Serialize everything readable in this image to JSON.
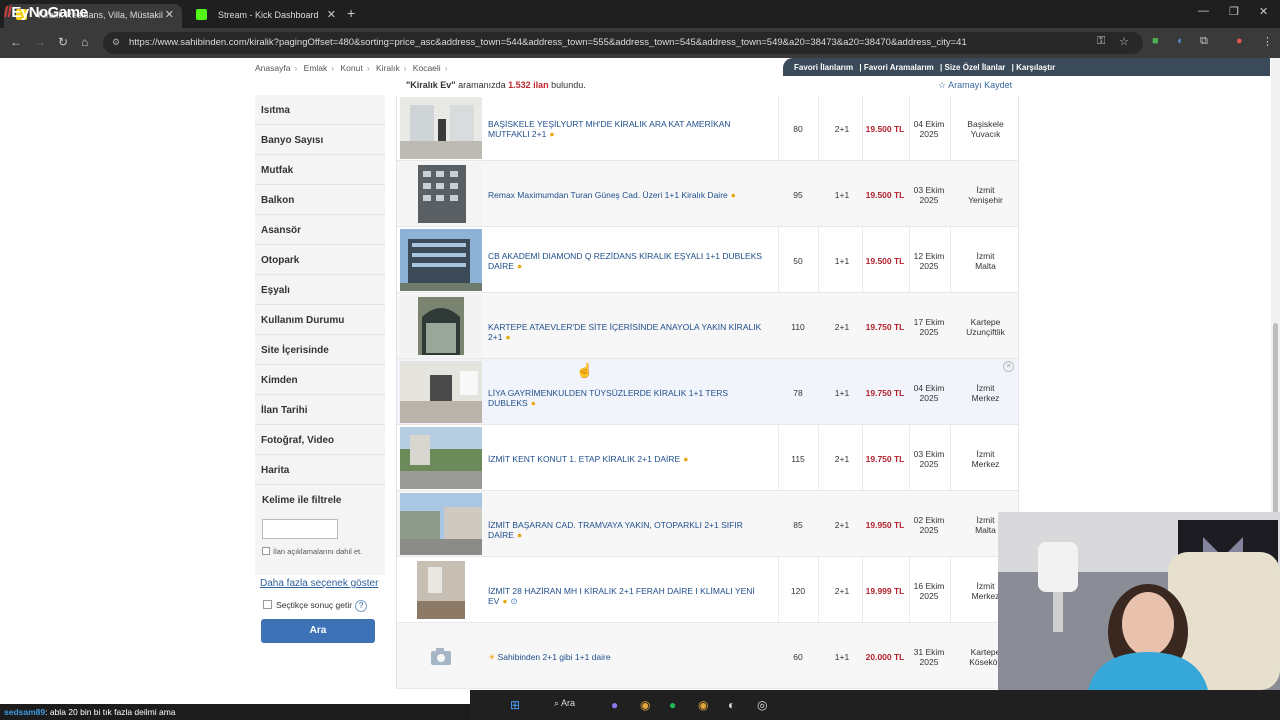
{
  "browser": {
    "logo_watermark": "EyNoGame",
    "tabs": [
      {
        "label": "Kiralık Residans, Villa, Müstakil",
        "active": true
      },
      {
        "label": "Stream - Kick Dashboard",
        "active": false
      }
    ],
    "url": "https://www.sahibinden.com/kiralik?pagingOffset=480&sorting=price_asc&address_town=544&address_town=555&address_town=545&address_town=549&a20=38473&a20=38470&address_city=41"
  },
  "breadcrumbs": [
    "Anasayfa",
    "Emlak",
    "Konut",
    "Kiralık",
    "Kocaeli"
  ],
  "top_nav": [
    "Favori İlanlarım",
    "Favori Aramalarım",
    "Size Özel İlanlar",
    "Karşılaştır"
  ],
  "results": {
    "query": "\"Kiralık Ev\"",
    "prefix": "aramanızda",
    "count": "1.532 ilan",
    "suffix": "bulundu.",
    "save_search": "Aramayı Kaydet"
  },
  "sidebar": {
    "filters": [
      "Isıtma",
      "Banyo Sayısı",
      "Mutfak",
      "Balkon",
      "Asansör",
      "Otopark",
      "Eşyalı",
      "Kullanım Durumu",
      "Site İçerisinde",
      "Kimden",
      "İlan Tarihi",
      "Fotoğraf, Video",
      "Harita"
    ],
    "keyword_title": "Kelime ile filtrele",
    "keyword_value": "",
    "keyword_checkbox": "İlan açıklamalarını dahil et.",
    "more_options": "Daha fazla seçenek göster",
    "selected_results": "Seçtikçe sonuç getir",
    "search_button": "Ara"
  },
  "listings": [
    {
      "title": "BAŞİSKELE YEŞİLYURT MH'DE KİRALIK ARA KAT AMERİKAN MUTFAKLI 2+1",
      "m2": "80",
      "rooms": "2+1",
      "price": "19.500 TL",
      "date_day": "04 Ekim",
      "date_year": "2025",
      "loc1": "Başiskele",
      "loc2": "Yuvacık"
    },
    {
      "title": "Remax Maximumdan Turan Güneş Cad. Üzeri 1+1 Kiralık Daire",
      "m2": "95",
      "rooms": "1+1",
      "price": "19.500 TL",
      "date_day": "03 Ekim",
      "date_year": "2025",
      "loc1": "İzmit",
      "loc2": "Yenişehir"
    },
    {
      "title": "CB AKADEMİ DIAMOND Q REZİDANS KİRALIK EŞYALI 1+1 DUBLEKS DAİRE",
      "m2": "50",
      "rooms": "1+1",
      "price": "19.500 TL",
      "date_day": "12 Ekim",
      "date_year": "2025",
      "loc1": "İzmit",
      "loc2": "Malta"
    },
    {
      "title": "KARTEPE ATAEVLER'DE SİTE İÇERİSİNDE ANAYOLA YAKIN KİRALIK 2+1",
      "m2": "110",
      "rooms": "2+1",
      "price": "19.750 TL",
      "date_day": "17 Ekim",
      "date_year": "2025",
      "loc1": "Kartepe",
      "loc2": "Uzunçiftlik"
    },
    {
      "title": "LİYA GAYRİMENKULDEN TÜYSÜZLERDE KİRALIK 1+1 TERS DUBLEKS",
      "m2": "78",
      "rooms": "1+1",
      "price": "19.750 TL",
      "date_day": "04 Ekim",
      "date_year": "2025",
      "loc1": "İzmit",
      "loc2": "Merkez"
    },
    {
      "title": "İZMİT KENT KONUT 1. ETAP KİRALIK 2+1 DAİRE",
      "m2": "115",
      "rooms": "2+1",
      "price": "19.750 TL",
      "date_day": "03 Ekim",
      "date_year": "2025",
      "loc1": "İzmit",
      "loc2": "Merkez"
    },
    {
      "title": "İZMİT BAŞARAN CAD. TRAMVAYA YAKIN, OTOPARKLI 2+1 SIFIR DAİRE",
      "m2": "85",
      "rooms": "2+1",
      "price": "19.950 TL",
      "date_day": "02 Ekim",
      "date_year": "2025",
      "loc1": "İzmit",
      "loc2": "Malta"
    },
    {
      "title": "İZMİT 28 HAZİRAN MH I KİRALIK 2+1 FERAH DAİRE I KLİMALI YENİ EV",
      "m2": "120",
      "rooms": "2+1",
      "price": "19.999 TL",
      "date_day": "16 Ekim",
      "date_year": "2025",
      "loc1": "İzmit",
      "loc2": "Merkez"
    },
    {
      "title": "Sahibinden 2+1 gibi 1+1 daire",
      "m2": "60",
      "rooms": "1+1",
      "price": "20.000 TL",
      "date_day": "31 Ekim",
      "date_year": "2025",
      "loc1": "Kartepe",
      "loc2": "Köseköy"
    }
  ],
  "chat": {
    "user": "sedsam89",
    "message": ": abla 20 bin bi tık fazla deilmi ama"
  },
  "taskbar": {
    "search_label": "Ara"
  },
  "colors": {
    "price": "#b3232e",
    "link": "#1f4e8c",
    "search_button": "#3d72b6",
    "topnav": "#3b4a59"
  }
}
